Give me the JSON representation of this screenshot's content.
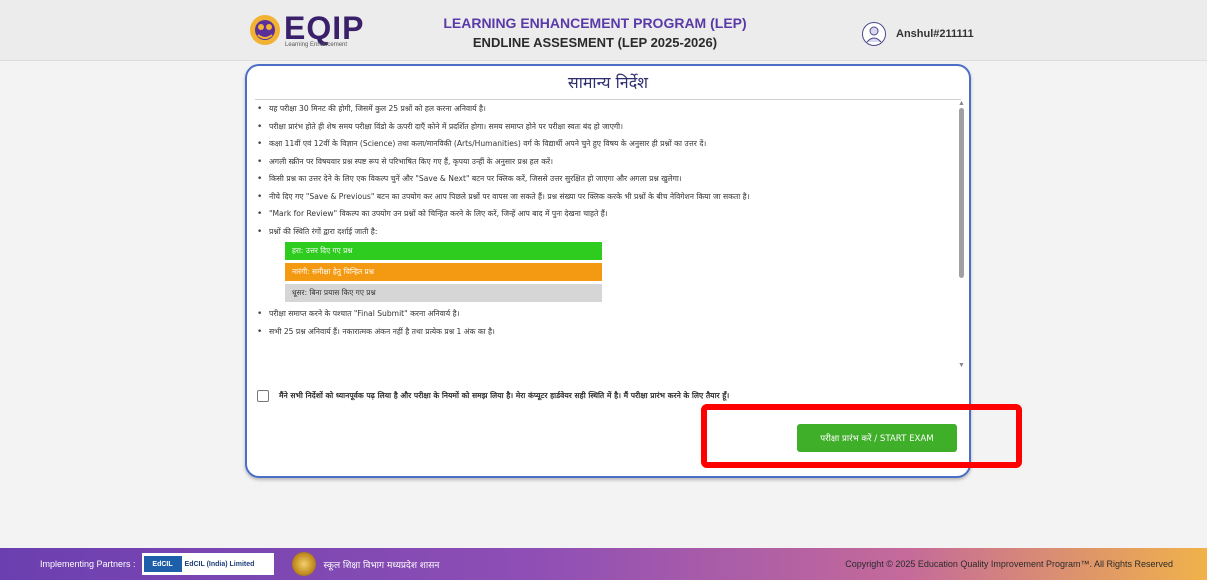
{
  "header": {
    "logo_text": "EQIP",
    "logo_subtext": "Learning Enhancement",
    "title_line1": "LEARNING ENHANCEMENT PROGRAM (LEP)",
    "title_line2": "ENDLINE ASSESMENT (LEP 2025-2026)",
    "user_name": "Anshul#211111",
    "user_icon": "user-avatar-icon"
  },
  "instructions": {
    "heading": "सामान्य निर्देश",
    "items": [
      "यह परीक्षा 30 मिनट की होगी, जिसमें कुल 25 प्रश्नों को हल करना अनिवार्य है।",
      "परीक्षा प्रारंभ होते ही शेष समय परीक्षा विंडो के ऊपरी दाएँ कोने में प्रदर्शित होगा। समय समाप्त होने पर परीक्षा स्वतः बंद हो जाएगी।",
      "कक्षा 11वीं एवं 12वीं के विज्ञान (Science) तथा कला/मानविकी (Arts/Humanities) वर्ग के विद्यार्थी अपने चुने हुए विषय के अनुसार ही प्रश्नों का उत्तर दें।",
      "अगली स्क्रीन पर विषयवार प्रश्न स्पष्ट रूप से परिभाषित किए गए हैं, कृपया उन्हीं के अनुसार प्रश्न हल करें।",
      "किसी प्रश्न का उत्तर देने के लिए एक विकल्प चुनें और \"Save & Next\" बटन पर क्लिक करें, जिससे उत्तर सुरक्षित हो जाएगा और अगला प्रश्न खुलेगा।",
      "नीचे दिए गए \"Save & Previous\" बटन का उपयोग कर आप पिछले प्रश्नों पर वापस जा सकते हैं। प्रश्न संख्या पर क्लिक करके भी प्रश्नों के बीच नेविगेशन किया जा सकता है।",
      "\"Mark for Review\" विकल्प का उपयोग उन प्रश्नों को चिन्हित करने के लिए करें, जिन्हें आप बाद में पुनः देखना चाहते हैं।",
      "प्रश्नों की स्थिति रंगों द्वारा दर्शाई जाती है:"
    ],
    "legend": [
      {
        "label": "हरा: उत्तर दिए गए प्रश्न",
        "color": "#2ecc1f",
        "text_color": "#ffffff"
      },
      {
        "label": "नारंगी: समीक्षा हेतु चिन्हित प्रश्न",
        "color": "#f39a12",
        "text_color": "#ffffff"
      },
      {
        "label": "धूसर: बिना प्रयास किए गए प्रश्न",
        "color": "#d6d6d6",
        "text_color": "#333333"
      }
    ],
    "items_after": [
      "परीक्षा समाप्त करने के पश्चात \"Final Submit\" करना अनिवार्य है।",
      "सभी 25 प्रश्न अनिवार्य हैं। नकारात्मक अंकन नहीं है तथा प्रत्येक प्रश्न 1 अंक का है।"
    ],
    "consent_text": "मैंने सभी निर्देशों को ध्यानपूर्वक पढ़ लिया है और परीक्षा के नियमों को समझ लिया है। मेरा कंप्यूटर हार्डवेयर सही स्थिति में है। मैं परीक्षा प्रारंभ करने के लिए तैयार हूँ।",
    "start_button": "परीक्षा प्रारंभ करें / START EXAM"
  },
  "footer": {
    "partners_label": "Implementing Partners :",
    "edcil_logo_text": "EdCIL",
    "edcil_name": "EdCIL (India) Limited",
    "dept_text": "स्कूल शिक्षा विभाग मध्यप्रदेश शासन",
    "copyright": "Copyright © 2025 Education Quality Improvement Program™. All Rights Reserved"
  }
}
